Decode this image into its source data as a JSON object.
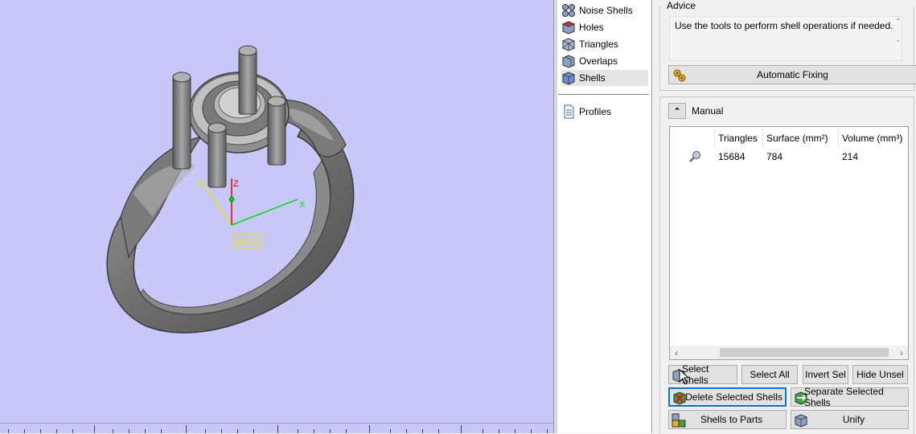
{
  "viewport": {
    "wcs_label": "WCS",
    "axis_x": "X",
    "axis_y": "Y",
    "axis_z": "Z",
    "background": "#c8c8f8"
  },
  "tree": {
    "items": [
      {
        "label": "Noise Shells",
        "icon": "noise-shells-icon"
      },
      {
        "label": "Holes",
        "icon": "holes-icon"
      },
      {
        "label": "Triangles",
        "icon": "triangles-icon"
      },
      {
        "label": "Overlaps",
        "icon": "overlaps-icon"
      },
      {
        "label": "Shells",
        "icon": "shells-icon",
        "selected": true
      },
      {
        "label": "Profiles",
        "icon": "profiles-icon"
      }
    ]
  },
  "advice": {
    "title": "Advice",
    "text": "Use the tools to perform shell operations if needed."
  },
  "auto_fix": {
    "label": "Automatic Fixing"
  },
  "manual": {
    "label": "Manual"
  },
  "shell_table": {
    "headers": [
      "Triangles",
      "Surface (mm²)",
      "Volume (mm³)"
    ],
    "rows": [
      {
        "triangles": "15684",
        "surface": "784",
        "volume": "214"
      }
    ]
  },
  "buttons": {
    "select_shells": "Select Shells",
    "select_all": "Select All",
    "invert_sel": "Invert Sel",
    "hide_unsel": "Hide Unsel",
    "delete_selected": "Delete Selected Shells",
    "separate_selected": "Separate Selected Shells",
    "shells_to_parts": "Shells to Parts",
    "unify": "Unify"
  }
}
